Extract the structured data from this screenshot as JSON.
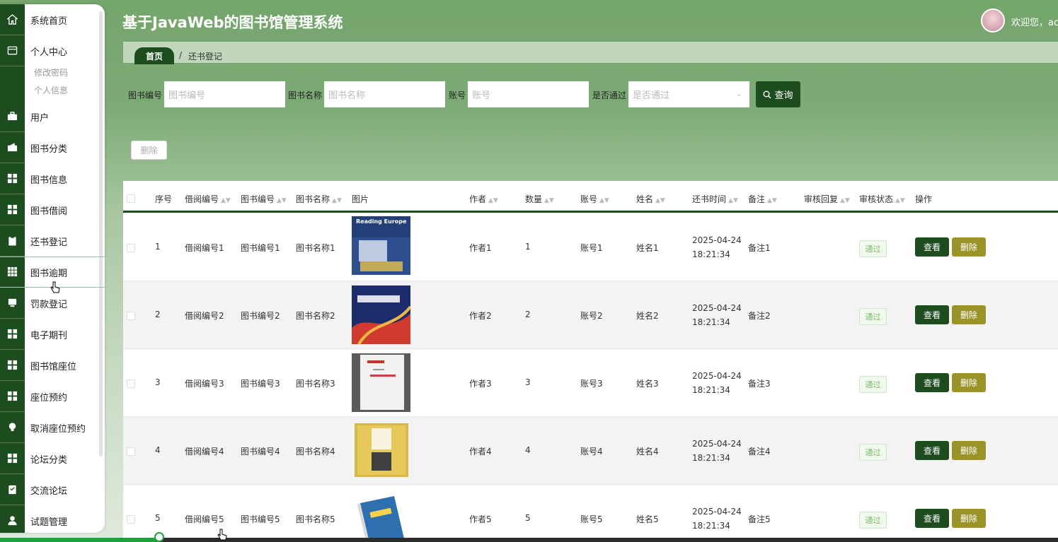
{
  "header": {
    "app_title": "基于JavaWeb的图书馆管理系统",
    "welcome": "欢迎您，ac"
  },
  "sidebar": {
    "items": [
      {
        "label": "系统首页",
        "icon": "home-icon"
      },
      {
        "label": "个人中心",
        "icon": "card-icon"
      },
      {
        "label": "用户",
        "icon": "briefcase-icon"
      },
      {
        "label": "图书分类",
        "icon": "wallet-icon"
      },
      {
        "label": "图书信息",
        "icon": "grid-icon"
      },
      {
        "label": "图书借阅",
        "icon": "grid-icon"
      },
      {
        "label": "还书登记",
        "icon": "clipboard-icon"
      },
      {
        "label": "图书逾期",
        "icon": "apps-icon"
      },
      {
        "label": "罚款登记",
        "icon": "monitor-icon"
      },
      {
        "label": "电子期刊",
        "icon": "grid-icon"
      },
      {
        "label": "图书馆座位",
        "icon": "grid-icon"
      },
      {
        "label": "座位预约",
        "icon": "grid-icon"
      },
      {
        "label": "取消座位预约",
        "icon": "bulb-icon"
      },
      {
        "label": "论坛分类",
        "icon": "grid-icon"
      },
      {
        "label": "交流论坛",
        "icon": "checklist-icon"
      },
      {
        "label": "试题管理",
        "icon": "user-icon"
      }
    ],
    "sub_items": [
      "修改密码",
      "个人信息"
    ]
  },
  "breadcrumb": {
    "home": "首页",
    "separator": "/",
    "current": "还书登记"
  },
  "search": {
    "book_no_label": "图书编号",
    "book_no_placeholder": "图书编号",
    "book_name_label": "图书名称",
    "book_name_placeholder": "图书名称",
    "account_label": "账号",
    "account_placeholder": "账号",
    "passed_label": "是否通过",
    "passed_placeholder": "是否通过",
    "query_button": "查询"
  },
  "toolbar": {
    "delete_button": "删除"
  },
  "table": {
    "columns": [
      "序号",
      "借阅编号",
      "图书编号",
      "图书名称",
      "图片",
      "作者",
      "数量",
      "账号",
      "姓名",
      "还书时间",
      "备注",
      "审核回复",
      "审核状态",
      "操作"
    ],
    "rows": [
      {
        "index": "1",
        "borrow_no": "借阅编号1",
        "book_no": "图书编号1",
        "book_name": "图书名称1",
        "author": "作者1",
        "qty": "1",
        "account": "账号1",
        "name": "姓名1",
        "date": "2025-04-24",
        "time": "18:21:34",
        "note": "备注1",
        "reply": "",
        "status": "通过",
        "view": "查看",
        "delete": "删除"
      },
      {
        "index": "2",
        "borrow_no": "借阅编号2",
        "book_no": "图书编号2",
        "book_name": "图书名称2",
        "author": "作者2",
        "qty": "2",
        "account": "账号2",
        "name": "姓名2",
        "date": "2025-04-24",
        "time": "18:21:34",
        "note": "备注2",
        "reply": "",
        "status": "通过",
        "view": "查看",
        "delete": "删除"
      },
      {
        "index": "3",
        "borrow_no": "借阅编号3",
        "book_no": "图书编号3",
        "book_name": "图书名称3",
        "author": "作者3",
        "qty": "3",
        "account": "账号3",
        "name": "姓名3",
        "date": "2025-04-24",
        "time": "18:21:34",
        "note": "备注3",
        "reply": "",
        "status": "通过",
        "view": "查看",
        "delete": "删除"
      },
      {
        "index": "4",
        "borrow_no": "借阅编号4",
        "book_no": "图书编号4",
        "book_name": "图书名称4",
        "author": "作者4",
        "qty": "4",
        "account": "账号4",
        "name": "姓名4",
        "date": "2025-04-24",
        "time": "18:21:34",
        "note": "备注4",
        "reply": "",
        "status": "通过",
        "view": "查看",
        "delete": "删除"
      },
      {
        "index": "5",
        "borrow_no": "借阅编号5",
        "book_no": "图书编号5",
        "book_name": "图书名称5",
        "author": "作者5",
        "qty": "5",
        "account": "账号5",
        "name": "姓名5",
        "date": "2025-04-24",
        "time": "18:21:34",
        "note": "备注5",
        "reply": "",
        "status": "通过",
        "view": "查看",
        "delete": "删除"
      }
    ],
    "cover_texts": [
      "Reading Europe",
      "",
      "",
      "",
      ""
    ]
  },
  "colors": {
    "primary": "#1d4d1f",
    "delete_button": "#9a9327",
    "status_badge": "#7cbf63",
    "progress": "#1ea33b"
  }
}
